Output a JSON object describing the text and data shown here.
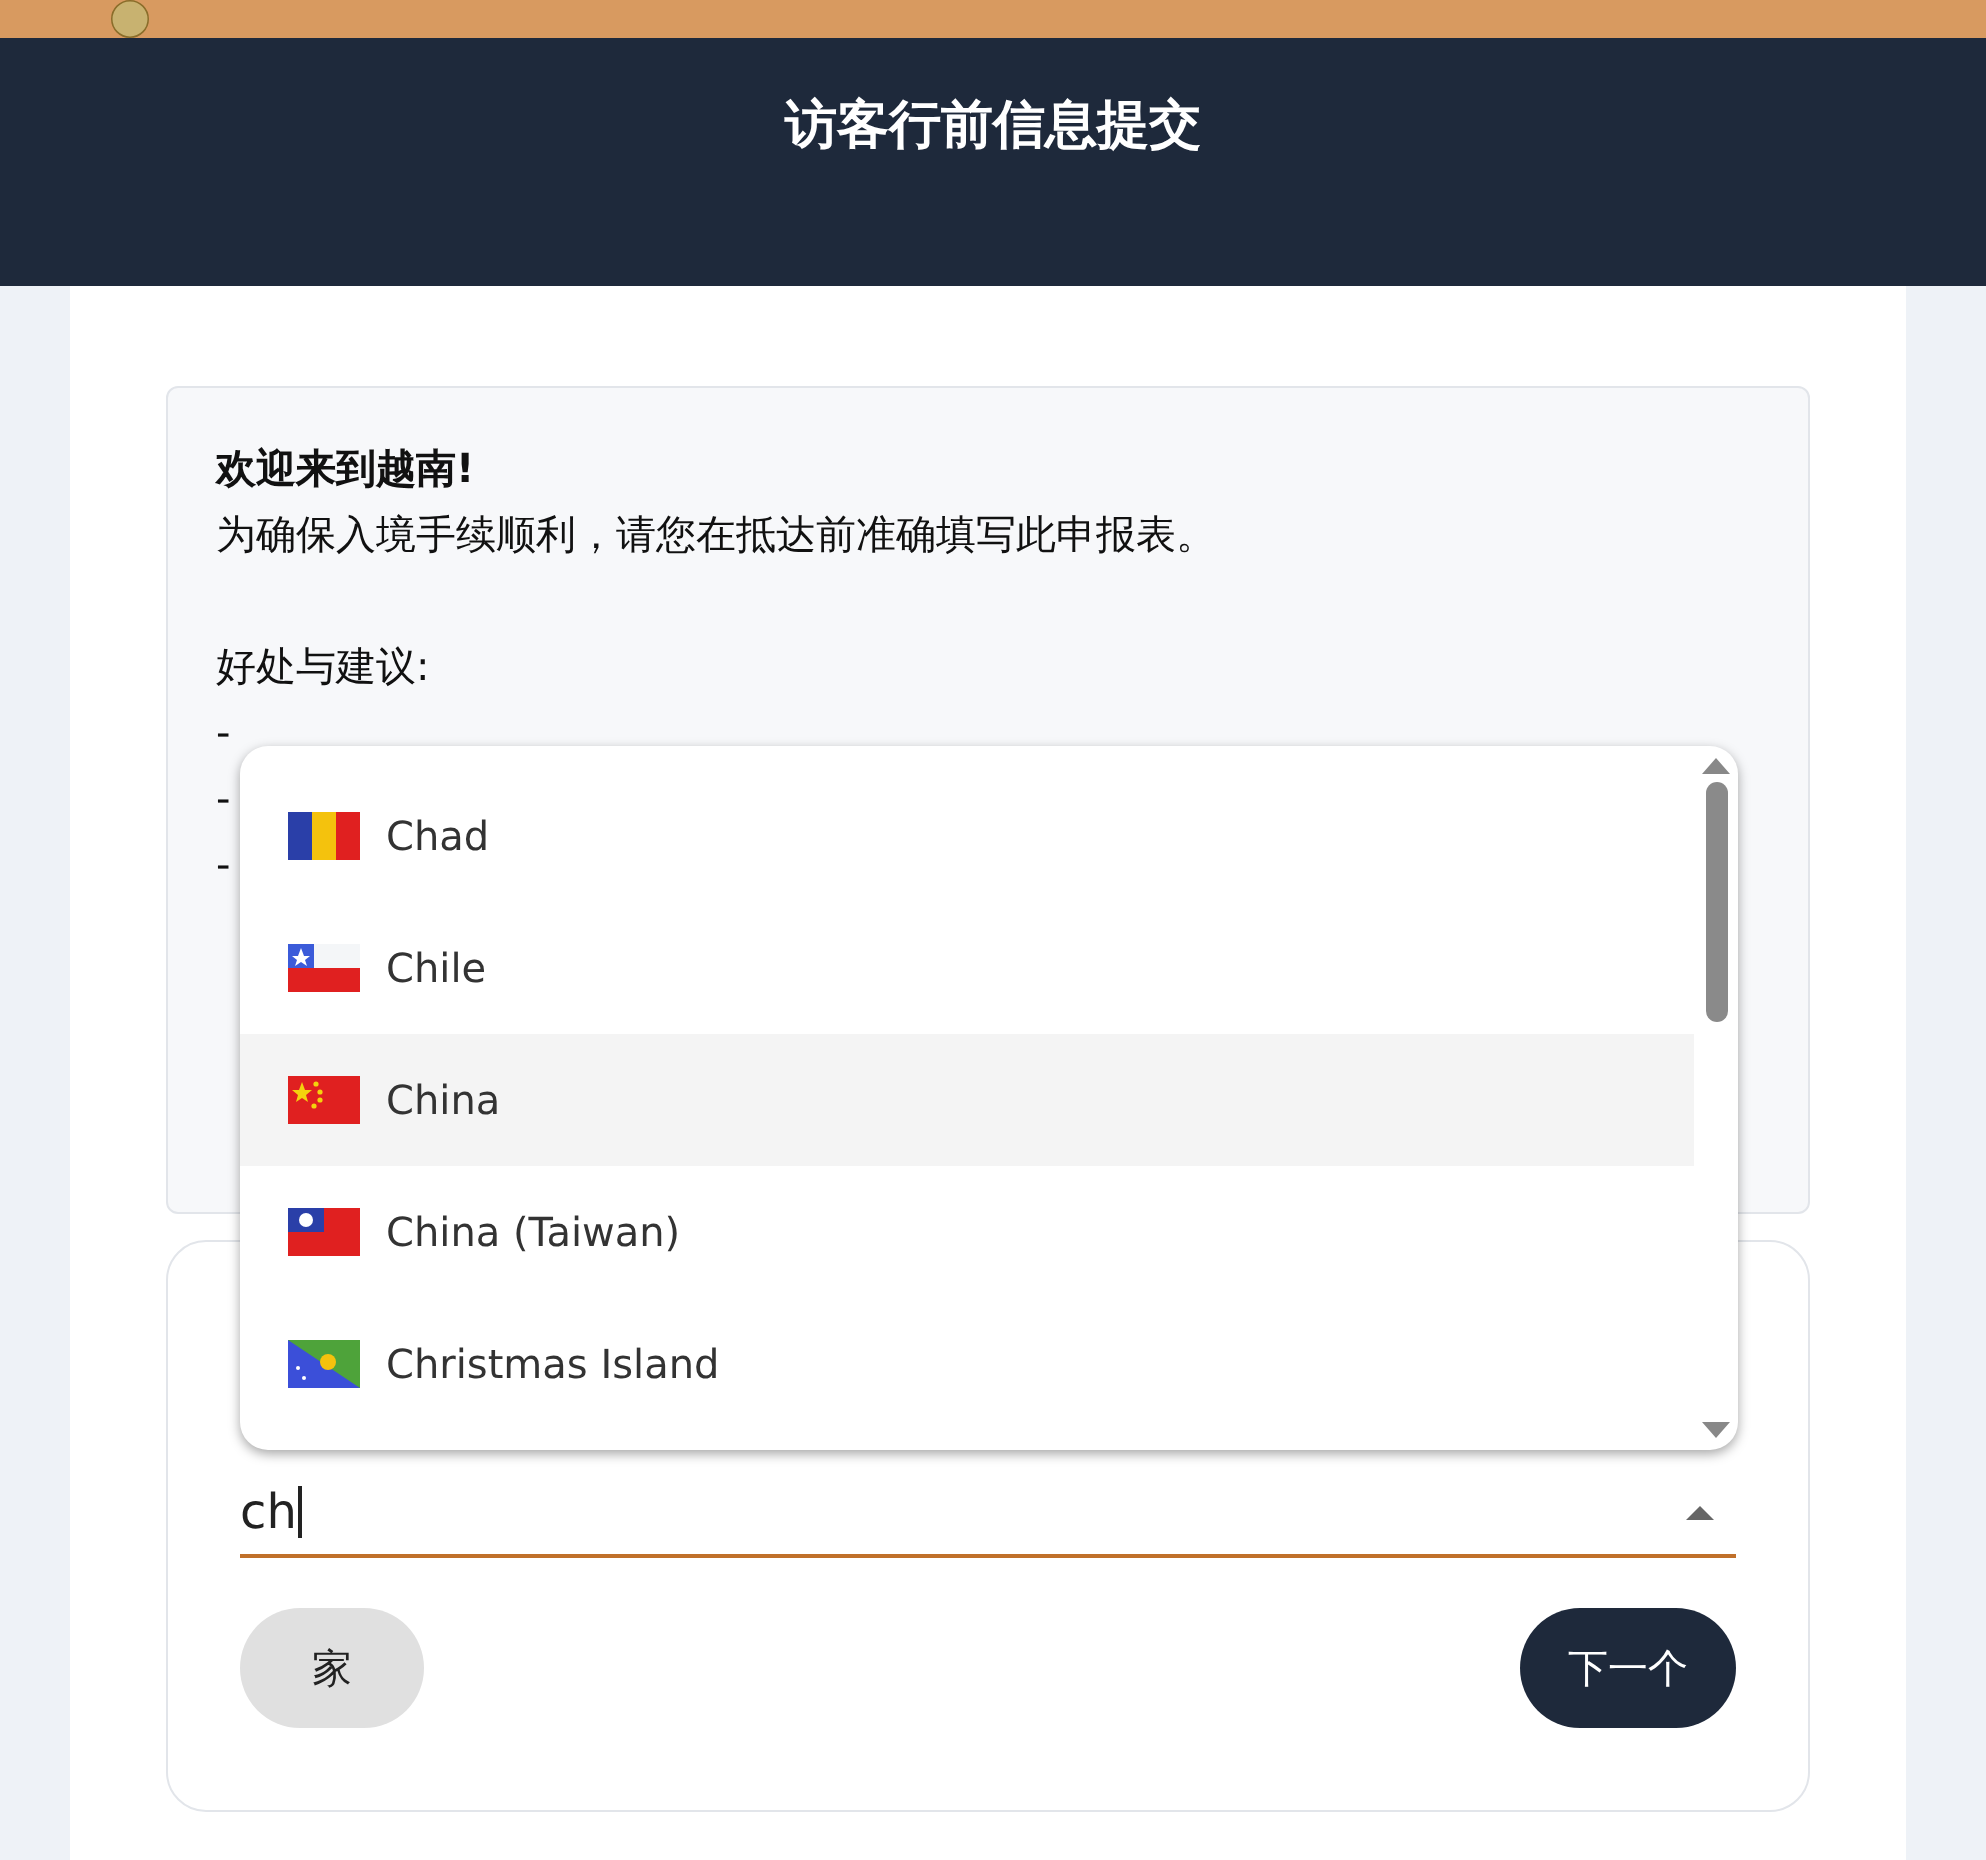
{
  "header": {
    "title": "访客行前信息提交"
  },
  "intro": {
    "heading": "欢迎来到越南!",
    "paragraphs": [
      [
        "为确保入境手续顺利，请您在抵达前准确填写此申报表。"
      ],
      [
        "好处与建议:",
        "-",
        "-",
        "-"
      ]
    ]
  },
  "form": {
    "field": {
      "value": "ch",
      "expanded": true
    },
    "options": [
      {
        "label": "Chad",
        "kind": "chad",
        "selected": false
      },
      {
        "label": "Chile",
        "kind": "chile",
        "selected": false
      },
      {
        "label": "China",
        "kind": "china",
        "selected": true
      },
      {
        "label": "China (Taiwan)",
        "kind": "taiwan",
        "selected": false
      },
      {
        "label": "Christmas Island",
        "kind": "christmas",
        "selected": false
      }
    ],
    "buttons": [
      {
        "label": "家",
        "kind": "secondary"
      },
      {
        "label": "下一个",
        "kind": "primary"
      }
    ]
  }
}
